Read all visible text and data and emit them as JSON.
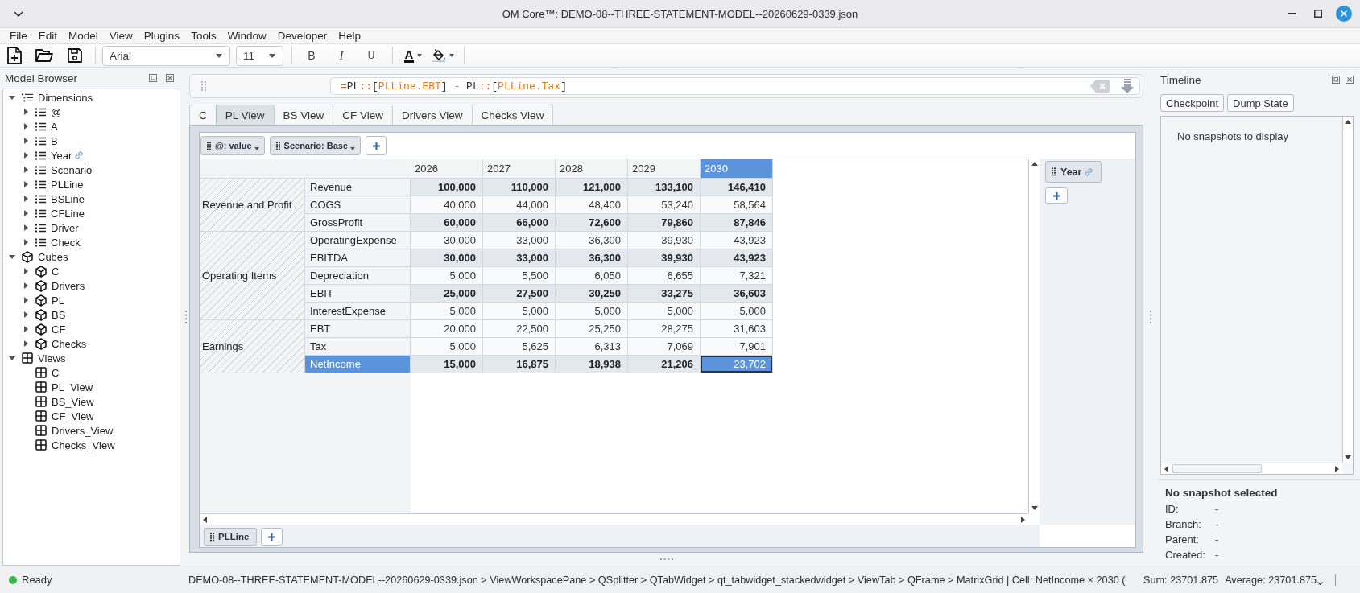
{
  "window": {
    "title": "OM Core™: DEMO-08--THREE-STATEMENT-MODEL--20260629-0339.json"
  },
  "menu": [
    "File",
    "Edit",
    "Model",
    "View",
    "Plugins",
    "Tools",
    "Window",
    "Developer",
    "Help"
  ],
  "toolbar": {
    "font": "Arial",
    "size": "11",
    "format_buttons": [
      {
        "label": "B",
        "kind": "bold"
      },
      {
        "label": "I",
        "kind": "italic"
      },
      {
        "label": "U",
        "kind": "underline"
      }
    ],
    "text_color_button": "A"
  },
  "model_browser": {
    "title": "Model Browser",
    "tree": [
      {
        "label": "Dimensions",
        "kind": "dimensions",
        "expanded": true,
        "children": [
          {
            "label": "@",
            "kind": "dimension",
            "expanded": false
          },
          {
            "label": "A",
            "kind": "dimension",
            "expanded": false
          },
          {
            "label": "B",
            "kind": "dimension",
            "expanded": false
          },
          {
            "label": "Year",
            "kind": "dimension",
            "expanded": false,
            "linked": true
          },
          {
            "label": "Scenario",
            "kind": "dimension",
            "expanded": false
          },
          {
            "label": "PLLine",
            "kind": "dimension",
            "expanded": false
          },
          {
            "label": "BSLine",
            "kind": "dimension",
            "expanded": false
          },
          {
            "label": "CFLine",
            "kind": "dimension",
            "expanded": false
          },
          {
            "label": "Driver",
            "kind": "dimension",
            "expanded": false
          },
          {
            "label": "Check",
            "kind": "dimension",
            "expanded": false
          }
        ]
      },
      {
        "label": "Cubes",
        "kind": "cube",
        "expanded": true,
        "children": [
          {
            "label": "C",
            "kind": "cube",
            "expanded": false
          },
          {
            "label": "Drivers",
            "kind": "cube",
            "expanded": false
          },
          {
            "label": "PL",
            "kind": "cube",
            "expanded": false
          },
          {
            "label": "BS",
            "kind": "cube",
            "expanded": false
          },
          {
            "label": "CF",
            "kind": "cube",
            "expanded": false
          },
          {
            "label": "Checks",
            "kind": "cube",
            "expanded": false
          }
        ]
      },
      {
        "label": "Views",
        "kind": "view",
        "expanded": true,
        "children": [
          {
            "label": "C",
            "kind": "view"
          },
          {
            "label": "PL_View",
            "kind": "view"
          },
          {
            "label": "BS_View",
            "kind": "view"
          },
          {
            "label": "CF_View",
            "kind": "view"
          },
          {
            "label": "Drivers_View",
            "kind": "view"
          },
          {
            "label": "Checks_View",
            "kind": "view"
          }
        ]
      }
    ]
  },
  "formula": [
    {
      "text": "=",
      "kind": "operator"
    },
    {
      "text": "PL",
      "kind": "name"
    },
    {
      "text": "::",
      "kind": "operator"
    },
    {
      "text": "[",
      "kind": "name"
    },
    {
      "text": "PLLine.EBT",
      "kind": "member"
    },
    {
      "text": "]",
      "kind": "name"
    },
    {
      "text": " - ",
      "kind": "operator"
    },
    {
      "text": "PL",
      "kind": "name"
    },
    {
      "text": "::",
      "kind": "operator"
    },
    {
      "text": "[",
      "kind": "name"
    },
    {
      "text": "PLLine.Tax",
      "kind": "member"
    },
    {
      "text": "]",
      "kind": "name"
    }
  ],
  "tabs": [
    {
      "label": "C",
      "selected": false
    },
    {
      "label": "PL View",
      "selected": true
    },
    {
      "label": "BS View",
      "selected": false
    },
    {
      "label": "CF View",
      "selected": false
    },
    {
      "label": "Drivers View",
      "selected": false
    },
    {
      "label": "Checks View",
      "selected": false
    }
  ],
  "pivot": {
    "filters": [
      {
        "label": "@: value"
      },
      {
        "label": "Scenario: Base"
      }
    ],
    "column_axis": [
      {
        "label": "Year",
        "linked": true
      }
    ],
    "row_axis": [
      {
        "label": "PLLine"
      }
    ]
  },
  "grid": {
    "columns": [
      {
        "label": "2026",
        "selected": false
      },
      {
        "label": "2027",
        "selected": false
      },
      {
        "label": "2028",
        "selected": false
      },
      {
        "label": "2029",
        "selected": false
      },
      {
        "label": "2030",
        "selected": true
      }
    ],
    "groups": [
      {
        "label": "Revenue and Profit",
        "rows": [
          {
            "label": "Revenue",
            "kind": "total",
            "selected": false,
            "values": [
              "100,000",
              "110,000",
              "121,000",
              "133,100",
              "146,410"
            ]
          },
          {
            "label": "COGS",
            "kind": "line",
            "selected": false,
            "values": [
              "40,000",
              "44,000",
              "48,400",
              "53,240",
              "58,564"
            ]
          },
          {
            "label": "GrossProfit",
            "kind": "total",
            "selected": false,
            "values": [
              "60,000",
              "66,000",
              "72,600",
              "79,860",
              "87,846"
            ]
          }
        ]
      },
      {
        "label": "Operating Items",
        "rows": [
          {
            "label": "OperatingExpense",
            "kind": "line",
            "selected": false,
            "values": [
              "30,000",
              "33,000",
              "36,300",
              "39,930",
              "43,923"
            ]
          },
          {
            "label": "EBITDA",
            "kind": "total",
            "selected": false,
            "values": [
              "30,000",
              "33,000",
              "36,300",
              "39,930",
              "43,923"
            ]
          },
          {
            "label": "Depreciation",
            "kind": "line",
            "selected": false,
            "values": [
              "5,000",
              "5,500",
              "6,050",
              "6,655",
              "7,321"
            ]
          },
          {
            "label": "EBIT",
            "kind": "total",
            "selected": false,
            "values": [
              "25,000",
              "27,500",
              "30,250",
              "33,275",
              "36,603"
            ]
          },
          {
            "label": "InterestExpense",
            "kind": "line",
            "selected": false,
            "values": [
              "5,000",
              "5,000",
              "5,000",
              "5,000",
              "5,000"
            ]
          }
        ]
      },
      {
        "label": "Earnings",
        "rows": [
          {
            "label": "EBT",
            "kind": "line",
            "selected": false,
            "values": [
              "20,000",
              "22,500",
              "25,250",
              "28,275",
              "31,603"
            ]
          },
          {
            "label": "Tax",
            "kind": "line",
            "selected": false,
            "values": [
              "5,000",
              "5,625",
              "6,313",
              "7,069",
              "7,901"
            ]
          },
          {
            "label": "NetIncome",
            "kind": "total",
            "selected": true,
            "values": [
              "15,000",
              "16,875",
              "18,938",
              "21,206",
              "23,702"
            ]
          }
        ]
      }
    ]
  },
  "timeline": {
    "title": "Timeline",
    "buttons": [
      "Checkpoint",
      "Dump State"
    ],
    "empty_message": "No snapshots to display",
    "details": {
      "heading": "No snapshot selected",
      "fields": [
        {
          "label": "ID:",
          "value": "-"
        },
        {
          "label": "Branch:",
          "value": "-"
        },
        {
          "label": "Parent:",
          "value": "-"
        },
        {
          "label": "Created:",
          "value": "-"
        }
      ]
    }
  },
  "status": {
    "text": "Ready",
    "color": "#3fb44e",
    "path": "DEMO-08--THREE-STATEMENT-MODEL--20260629-0339.json > ViewWorkspacePane > QSplitter > QTabWidget > qt_tabwidget_stackedwidget > ViewTab > QFrame > MatrixGrid | Cell: NetIncome × 2030 (",
    "sum": "Sum: 23701.875",
    "average": "Average: 23701.875"
  }
}
